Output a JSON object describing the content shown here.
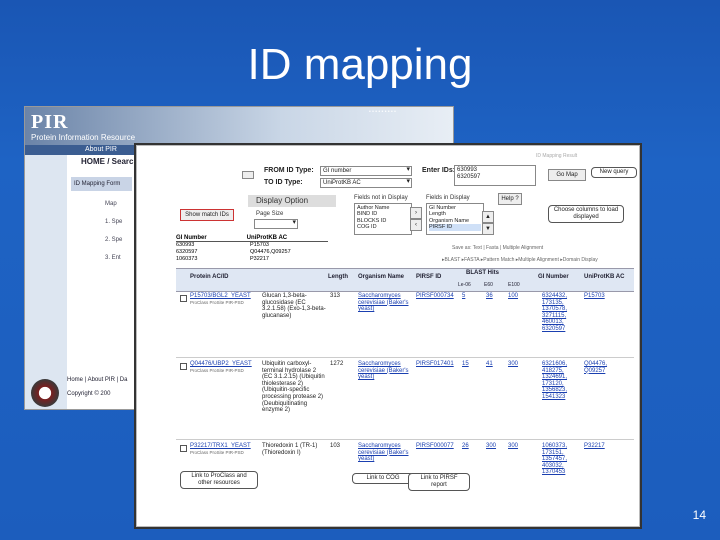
{
  "slide": {
    "title": "ID mapping",
    "page_number": "14"
  },
  "pir_window": {
    "logo": "PIR",
    "subtitle": "Protein Information Resource",
    "right_text": "• • • • • • • • •",
    "nav": "About PIR",
    "home": "HOME / Search",
    "tab": "ID Mapping Form",
    "steps": [
      "Map",
      "1. Spe",
      "2. Spe",
      "3. Ent"
    ],
    "footer": "Home | About PIR | Da",
    "copyright": "Copyright © 200"
  },
  "form": {
    "breadcrumb": "ID Mapping Result",
    "from_label": "FROM ID Type:",
    "from_value": "GI number",
    "to_label": "TO ID Type:",
    "to_value": "UniProtKB AC",
    "enter_label": "Enter IDs:",
    "ids": [
      "630993",
      "6320597"
    ],
    "go_button": "Go Map",
    "callout_new_query": "New query",
    "display_option": "Display Option",
    "show_match_label": "Show match IDs",
    "page_size_label": "Page Size",
    "help_label": "Help ?",
    "fields_not_label": "Fields not in Display",
    "fields_in_label": "Fields in Display",
    "fields_not": [
      "Author Name",
      "BIND ID",
      "BLOCKS ID",
      "COG ID"
    ],
    "fields_in": [
      "GI Number",
      "Length",
      "Organism Name",
      "PIRSF ID"
    ],
    "callout_cols": "Choose columns to load displayed",
    "mapping_header": [
      "GI Number",
      "UniProtKB AC"
    ],
    "mapping": [
      {
        "gi": "630993",
        "ac": "P15703"
      },
      {
        "gi": "6320597",
        "ac": "Q04476,Q09257"
      },
      {
        "gi": "1060373",
        "ac": "P32217"
      }
    ]
  },
  "table": {
    "link_bar": "Save as: Text | Fasta | Multiple Alignment",
    "actions": "▸BLAST  ▸FASTA  ▸Pattern Match  ▸Multiple Alignment  ▸Domain Display",
    "headers": [
      "Protein AC/ID",
      "Length",
      "Organism Name",
      "PIRSF ID",
      "BLAST Hits",
      "GI Number",
      "UniProtKB AC"
    ],
    "blast_sub": [
      "Le-06",
      "E60",
      "E100"
    ],
    "rows": [
      {
        "id": "P15703/BGL2_YEAST",
        "name": "Glucan 1,3-beta-glucosidase (EC 3.2.1.58) (Exo-1,3-beta-glucanase)",
        "length": "313",
        "organism": "Saccharomyces cerevisiae (Baker's yeast)",
        "pirsf": "PIRSF000734",
        "b1": "5",
        "b2": "36",
        "b3": "100",
        "gi": "6324432, 173135, 1370578, 3271115, 460013, 6320597",
        "ac": "P15703"
      },
      {
        "id": "Q04476/UBP2_YEAST",
        "name": "Ubiquitin carboxyl-terminal hydrolase 2 (EC 3.1.2.15) (Ubiquitin thiolesterase 2) (Ubiquitin-specific processing protease 2) (Deubiquitinating enzyme 2)",
        "length": "1272",
        "organism": "Saccharomyces cerevisiae (Baker's yeast)",
        "pirsf": "PIRSF017401",
        "b1": "15",
        "b2": "41",
        "b3": "300",
        "gi": "6321606, 418275, 1324691, 173120, 1356823, 1541323",
        "ac": "Q04476, Q09257"
      },
      {
        "id": "P32217/TRX1_YEAST",
        "name": "Thioredoxin 1 (TR-1) (Thioredoxin I)",
        "length": "103",
        "organism": "Saccharomyces cerevisiae (Baker's yeast)",
        "pirsf": "PIRSF000077",
        "b1": "26",
        "b2": "300",
        "b3": "300",
        "gi": "1060373, 173151, 1357457, 403032, 1370453",
        "ac": "P32217"
      }
    ],
    "row_sub": "ProClass  ProSite  PIR-PSD",
    "callout_bottom_left": "Link to ProClass and other resources",
    "callout_bottom_mid": "Link to COG",
    "callout_bottom_right": "Link to PIRSF report"
  },
  "colors": {
    "slide_bg": "#1e63c4",
    "link": "#1a3fb0",
    "table_head": "#dfe7f3"
  }
}
